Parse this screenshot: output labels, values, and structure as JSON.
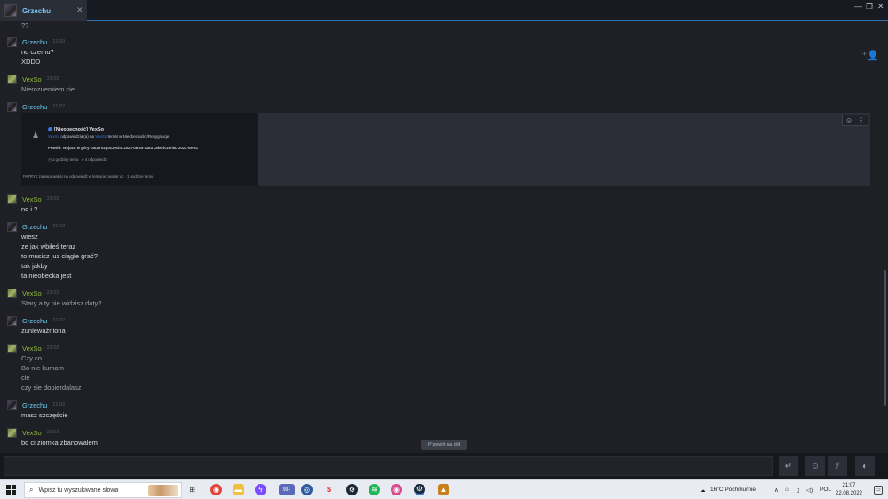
{
  "window": {
    "tab_name": "Grzechu",
    "tab_close": "✕",
    "minimize": "—",
    "maximize": "❐",
    "close": "✕",
    "add_friend_icon": "⁺👤"
  },
  "messages": {
    "top_fragment": "??",
    "m1": {
      "sender": "Grzechu",
      "time": "21:00",
      "lines": [
        "no czemu?",
        "XDDD"
      ]
    },
    "m2": {
      "sender": "VexSo",
      "time": "21:02",
      "lines": [
        "Nierozuemiem cie"
      ]
    },
    "m3": {
      "sender": "Grzechu",
      "time": "21:02"
    },
    "m4": {
      "sender": "VexSo",
      "time": "21:02",
      "lines": [
        "no i ?"
      ]
    },
    "m5": {
      "sender": "Grzechu",
      "time": "21:02",
      "lines": [
        "wiesz",
        "ze jak wbiłeś teraz",
        "to musisz juz ciągle grać?",
        "tak jakby",
        "ta nieobecka jest"
      ]
    },
    "m6": {
      "sender": "VexSo",
      "time": "21:02",
      "lines": [
        "Stary a ty nie widzisz daty?"
      ]
    },
    "m7": {
      "sender": "Grzechu",
      "time": "21:02",
      "lines": [
        "zunieważniona"
      ]
    },
    "m8": {
      "sender": "VexSo",
      "time": "21:02",
      "lines": [
        "Czy co",
        "Bo nie kumam",
        "cie",
        "czy sie dopierdalasz"
      ]
    },
    "m9": {
      "sender": "Grzechu",
      "time": "21:02",
      "lines": [
        "masz szczęście"
      ]
    },
    "m10": {
      "sender": "VexSo",
      "time": "21:02",
      "lines": [
        "bo ci ziomka zbanowalem"
      ]
    }
  },
  "embed": {
    "title": "[Nieobecność] VexSo",
    "sub_user": "VexSo",
    "sub_mid": "odpowiedział(a) na",
    "sub_user2": "VexSo",
    "sub_end": "temat w Nieobecności/Rezygnacje",
    "info": "Powód: Wyjazd w góry Data rozpoczęcia: 2022-08-25 Data zakończenia: 2022-08-31",
    "meta_time": "1 godzinę temu",
    "meta_replies": "4 odpowiedzi",
    "footer": "PATRYK zareagował(a) na odpowiedź w temacie: avatar v2   ·   1 godzinę temu"
  },
  "scroll_down_label": "Przewiń na dół",
  "input": {
    "value": ""
  },
  "taskbar": {
    "search_placeholder": "Wpisz tu wyszukiwane słowa",
    "weather": "16°C  Pochmurnie",
    "lang": "POL",
    "time": "21:07",
    "date": "22.08.2022",
    "apps": [
      "task-view",
      "chrome",
      "explorer",
      "messenger",
      "teams",
      "app-blue",
      "app-red",
      "steam",
      "steam2",
      "spotify",
      "chrome2",
      "steam3",
      "app-game"
    ],
    "badge": "99+"
  }
}
